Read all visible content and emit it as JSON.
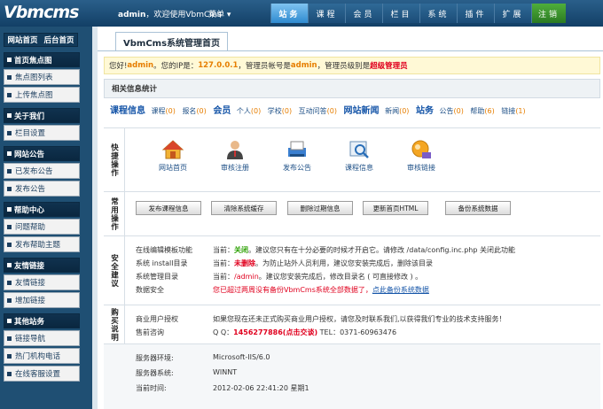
{
  "header": {
    "logo": "Vbmcms",
    "welcome_user": "admin",
    "welcome_text": "，欢迎使用VbmCms",
    "menu_label": "菜单",
    "nav_tabs": [
      "站务",
      "课程",
      "会员",
      "栏目",
      "系统",
      "插件",
      "扩展",
      "注销"
    ],
    "active_tab": "站务"
  },
  "sidebar": {
    "site_home": "网站首页",
    "admin_home": "后台首页",
    "groups": [
      {
        "title": "首页焦点图",
        "items": [
          "焦点图列表",
          "上传焦点图"
        ]
      },
      {
        "title": "关于我们",
        "items": [
          "栏目设置"
        ]
      },
      {
        "title": "网站公告",
        "items": [
          "已发布公告",
          "发布公告"
        ]
      },
      {
        "title": "帮助中心",
        "items": [
          "问题帮助",
          "发布帮助主题"
        ]
      },
      {
        "title": "友情链接",
        "items": [
          "友情链接",
          "增加链接"
        ]
      },
      {
        "title": "其他站务",
        "items": [
          "链接导航",
          "热门机构电话",
          "在线客服设置"
        ]
      }
    ]
  },
  "main": {
    "page_title": "VbmCms系统管理首页",
    "greeting": {
      "p1": "您好! ",
      "user": "admin",
      "p2": "。您的IP是：",
      "ip": "127.0.0.1",
      "p3": "，管理员帐号是",
      "account": "admin",
      "p4": "，管理员级别是",
      "level": "超级管理员"
    },
    "stats_title": "相关信息统计",
    "stats": [
      {
        "cat": "课程信息",
        "items": [
          {
            "l": "课程",
            "n": "(0)"
          },
          {
            "l": "报名",
            "n": "(0)"
          }
        ]
      },
      {
        "cat": "会员",
        "items": [
          {
            "l": "个人",
            "n": "(0)"
          },
          {
            "l": "学校",
            "n": "(0)"
          },
          {
            "l": "互动问答",
            "n": "(0)"
          }
        ]
      },
      {
        "cat": "网站新闻",
        "items": [
          {
            "l": "新闻",
            "n": "(0)"
          }
        ]
      },
      {
        "cat": "站务",
        "items": [
          {
            "l": "公告",
            "n": "(0)"
          },
          {
            "l": "帮助",
            "n": "(6)"
          },
          {
            "l": "链接",
            "n": "(1)"
          }
        ]
      }
    ],
    "quick": {
      "label": "快捷操作",
      "icons": [
        {
          "label": "网站首页",
          "icon": "home-icon"
        },
        {
          "label": "审核注册",
          "icon": "user-icon"
        },
        {
          "label": "发布公告",
          "icon": "publish-icon"
        },
        {
          "label": "课程信息",
          "icon": "course-search-icon"
        },
        {
          "label": "审核链接",
          "icon": "link-check-icon"
        }
      ]
    },
    "common": {
      "label": "常用操作",
      "buttons": [
        "发布课程信息",
        "清除系统缓存",
        "删除过期信息",
        "更新首页HTML",
        "备份系统数据"
      ]
    },
    "security": {
      "label": "安全建议",
      "rows": [
        {
          "k": "在线编辑模板功能",
          "pre": "当前：",
          "status": "关闭",
          "status_color": "#2aa000",
          "rest": "。建议您只有在十分必要的时候才开启它。请修改 /data/config.inc.php 关闭此功能"
        },
        {
          "k": "系统 install目录",
          "pre": "当前：",
          "status": "未删除",
          "status_color": "#e0001e",
          "rest": "。为防止站外人员利用，建议您安装完成后，删除该目录"
        },
        {
          "k": "系统管理目录",
          "pre": "当前：",
          "status": "/admin",
          "status_color": "#e0001e",
          "rest": "。建议您安装完成后，修改目录名 ( 可直接修改 ) 。"
        },
        {
          "k": "数据安全",
          "pre": "",
          "status": "您已超过两周没有备份VbmCms系统全部数据了，",
          "status_color": "#e0001e",
          "link": "点此备份系统数据"
        }
      ]
    },
    "purchase": {
      "label": "购买说明",
      "rows": [
        {
          "k": "商业用户授权",
          "v": "如果您现在还未正式购买商业用户授权，请您及时联系我们,以获得我们专业的技术支持服务！"
        },
        {
          "k": "售前咨询",
          "pre": "Q Q：",
          "qq": "1456277886(点击交谈)",
          "tel": " TEL：0371-60963476"
        }
      ]
    },
    "server": {
      "rows": [
        {
          "k": "服务器环境:",
          "v": "Microsoft-IIS/6.0"
        },
        {
          "k": "服务器系统:",
          "v": "WINNT"
        },
        {
          "k": "当前时间:",
          "v": "2012-02-06 22:41:20 星期1"
        }
      ]
    }
  }
}
